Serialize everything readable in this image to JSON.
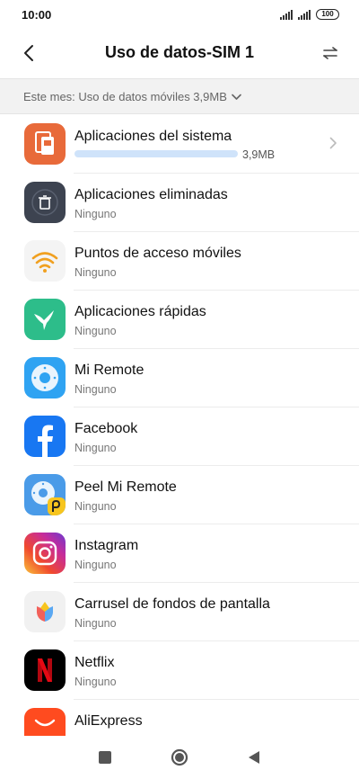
{
  "status_bar": {
    "time": "10:00",
    "battery": "100"
  },
  "header": {
    "title": "Uso de datos-SIM 1"
  },
  "filter": {
    "label": "Este mes: Uso de datos móviles 3,9MB"
  },
  "apps": [
    {
      "name": "Aplicaciones del sistema",
      "usage": "3,9MB",
      "usage_fraction": 1.0
    },
    {
      "name": "Aplicaciones eliminadas",
      "sub": "Ninguno"
    },
    {
      "name": "Puntos de acceso móviles",
      "sub": "Ninguno"
    },
    {
      "name": "Aplicaciones rápidas",
      "sub": "Ninguno"
    },
    {
      "name": "Mi Remote",
      "sub": "Ninguno"
    },
    {
      "name": "Facebook",
      "sub": "Ninguno"
    },
    {
      "name": "Peel Mi Remote",
      "sub": "Ninguno"
    },
    {
      "name": "Instagram",
      "sub": "Ninguno"
    },
    {
      "name": "Carrusel de fondos de pantalla",
      "sub": "Ninguno"
    },
    {
      "name": "Netflix",
      "sub": "Ninguno"
    },
    {
      "name": "AliExpress",
      "sub": ""
    }
  ],
  "colors": {
    "system_icon": "#e86a3a",
    "usage_bar": "#cfe3fa",
    "facebook": "#1877f2",
    "netflix": "#e50914",
    "aliexpress": "#ff4b1f"
  }
}
